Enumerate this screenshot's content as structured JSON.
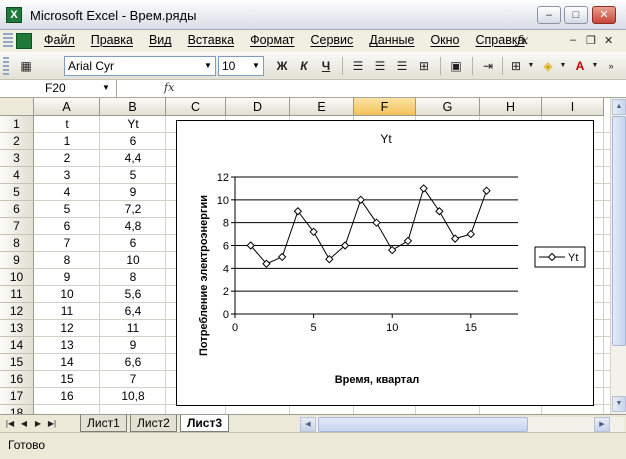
{
  "window": {
    "title": "Microsoft Excel - Врем.ряды",
    "app_icon_glyph": "X"
  },
  "menu": {
    "items": [
      "Файл",
      "Правка",
      "Вид",
      "Вставка",
      "Формат",
      "Сервис",
      "Данные",
      "Окно",
      "Справка"
    ],
    "fx_glyph": "ƒx"
  },
  "toolbar": {
    "font_name": "Arial Cyr",
    "font_size": "10",
    "bold": "Ж",
    "italic": "К",
    "underline": "Ч"
  },
  "formula_bar": {
    "cell_ref": "F20",
    "fx_label": "fx",
    "value": ""
  },
  "grid": {
    "columns": [
      "A",
      "B",
      "C",
      "D",
      "E",
      "F",
      "G",
      "H",
      "I"
    ],
    "selected_column": "F",
    "rows": [
      "1",
      "2",
      "3",
      "4",
      "5",
      "6",
      "7",
      "8",
      "9",
      "10",
      "11",
      "12",
      "13",
      "14",
      "15",
      "16",
      "17",
      "18"
    ],
    "cells": [
      [
        "t",
        "Yt"
      ],
      [
        "1",
        "6"
      ],
      [
        "2",
        "4,4"
      ],
      [
        "3",
        "5"
      ],
      [
        "4",
        "9"
      ],
      [
        "5",
        "7,2"
      ],
      [
        "6",
        "4,8"
      ],
      [
        "7",
        "6"
      ],
      [
        "8",
        "10"
      ],
      [
        "9",
        "8"
      ],
      [
        "10",
        "5,6"
      ],
      [
        "11",
        "6,4"
      ],
      [
        "12",
        "11"
      ],
      [
        "13",
        "9"
      ],
      [
        "14",
        "6,6"
      ],
      [
        "15",
        "7"
      ],
      [
        "16",
        "10,8"
      ]
    ]
  },
  "chart_data": {
    "type": "line",
    "title": "Yt",
    "xlabel": "Время, квартал",
    "ylabel": "Потребление электроэнергии",
    "x": [
      1,
      2,
      3,
      4,
      5,
      6,
      7,
      8,
      9,
      10,
      11,
      12,
      13,
      14,
      15,
      16
    ],
    "series": [
      {
        "name": "Yt",
        "values": [
          6,
          4.4,
          5,
          9,
          7.2,
          4.8,
          6,
          10,
          8,
          5.6,
          6.4,
          11,
          9,
          6.6,
          7,
          10.8
        ]
      }
    ],
    "xlim": [
      0,
      18
    ],
    "ylim": [
      0,
      12
    ],
    "xticks": [
      0,
      5,
      10,
      15
    ],
    "yticks": [
      0,
      2,
      4,
      6,
      8,
      10,
      12
    ],
    "grid": "horizontal",
    "legend": "right",
    "marker": "diamond",
    "line_color": "#000000"
  },
  "sheet_tabs": [
    "Лист1",
    "Лист2",
    "Лист3"
  ],
  "active_tab": "Лист3",
  "status": {
    "text": "Готово"
  }
}
